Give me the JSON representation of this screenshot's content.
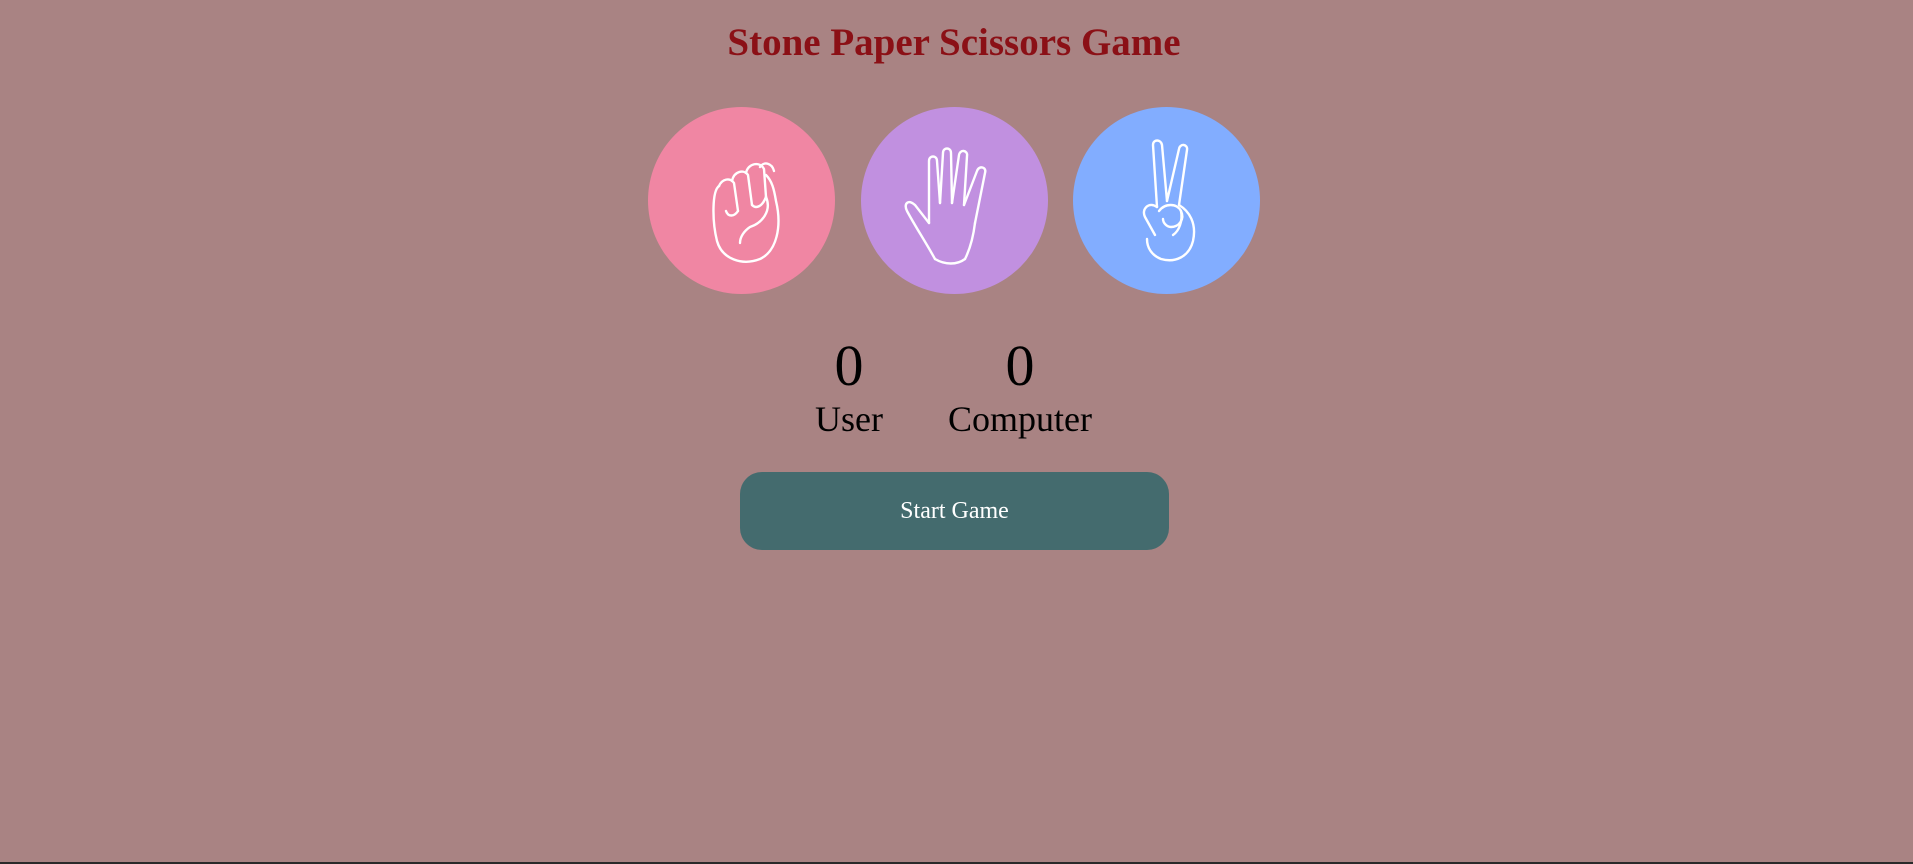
{
  "header": {
    "title": "Stone Paper Scissors Game"
  },
  "choices": [
    {
      "name": "rock",
      "icon": "fist-icon",
      "color": "#f086a3"
    },
    {
      "name": "paper",
      "icon": "open-hand-icon",
      "color": "#c190e0"
    },
    {
      "name": "scissors",
      "icon": "peace-hand-icon",
      "color": "#82adff"
    }
  ],
  "scoreboard": {
    "user": {
      "score": "0",
      "label": "User"
    },
    "computer": {
      "score": "0",
      "label": "Computer"
    }
  },
  "actions": {
    "start_label": "Start Game",
    "start_color": "#446b6e"
  },
  "theme": {
    "background": "#a98383",
    "title_color": "#8b1016"
  }
}
